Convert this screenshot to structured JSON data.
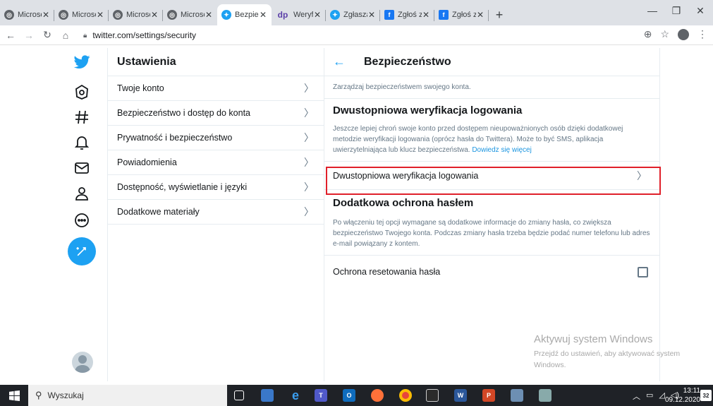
{
  "browser": {
    "tabs": [
      {
        "title": "Microsoft",
        "icon": "globe-icon",
        "active": false
      },
      {
        "title": "Microsoft",
        "icon": "globe-icon",
        "active": false
      },
      {
        "title": "Microsoft",
        "icon": "globe-icon",
        "active": false
      },
      {
        "title": "Microsoft",
        "icon": "globe-icon",
        "active": false
      },
      {
        "title": "Bezpiecze",
        "icon": "twitter-icon",
        "active": true
      },
      {
        "title": "Weryfikac",
        "icon": "dp-icon",
        "favicon_text": "dp",
        "active": false
      },
      {
        "title": "Zgłaszani",
        "icon": "twitter-icon",
        "active": false
      },
      {
        "title": "Zgłoś zła",
        "icon": "facebook-icon",
        "active": false
      },
      {
        "title": "Zgłoś zła",
        "icon": "facebook-icon",
        "active": false
      }
    ],
    "close_glyph": "✕",
    "new_tab": "+",
    "url": "twitter.com/settings/security"
  },
  "twitter_nav": {
    "items": [
      {
        "name": "twitter-logo-icon"
      },
      {
        "name": "explore-icon"
      },
      {
        "name": "hashtag-icon"
      },
      {
        "name": "bell-icon"
      },
      {
        "name": "mail-icon"
      },
      {
        "name": "profile-icon"
      },
      {
        "name": "more-icon"
      },
      {
        "name": "compose-tweet-icon"
      }
    ],
    "accent": "#1da1f2"
  },
  "settings": {
    "title": "Ustawienia",
    "items": [
      {
        "label": "Twoje konto"
      },
      {
        "label": "Bezpieczeństwo i dostęp do konta"
      },
      {
        "label": "Prywatność i bezpieczeństwo"
      },
      {
        "label": "Powiadomienia"
      },
      {
        "label": "Dostępność, wyświetlanie i języki"
      },
      {
        "label": "Dodatkowe materiały"
      }
    ]
  },
  "security": {
    "title": "Bezpieczeństwo",
    "subtitle": "Zarządzaj bezpieczeństwem swojego konta.",
    "twofa": {
      "heading": "Dwustopniowa weryfikacja logowania",
      "description": "Jeszcze lepiej chroń swoje konto przed dostępem nieupoważnionych osób dzięki dodatkowej metodzie weryfikacji logowania (oprócz hasła do Twittera). Może to być SMS, aplikacja uwierzytelniająca lub klucz bezpieczeństwa.",
      "learn_more": "Dowiedz się więcej",
      "row_label": "Dwustopniowa weryfikacja logowania"
    },
    "password_protection": {
      "heading": "Dodatkowa ochrona hasłem",
      "description": "Po włączeniu tej opcji wymagane są dodatkowe informacje do zmiany hasła, co zwiększa bezpieczeństwo Twojego konta. Podczas zmiany hasła trzeba będzie podać numer telefonu lub adres e-mail powiązany z kontem.",
      "checkbox_label": "Ochrona resetowania hasła",
      "checked": false
    },
    "highlight_color": "#e0202a"
  },
  "watermark": {
    "line1": "Aktywuj system Windows",
    "line2": "Przejdź do ustawień, aby aktywować system Windows."
  },
  "taskbar": {
    "search_placeholder": "Wyszukaj",
    "time": "13:11",
    "date": "09.12.2020",
    "notifications": "32"
  }
}
